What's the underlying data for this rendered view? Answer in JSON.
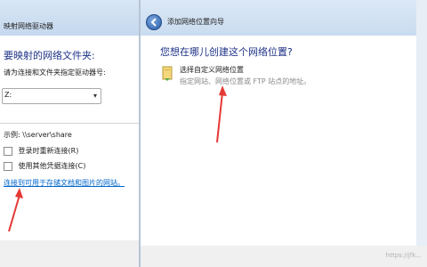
{
  "background_dialog": {
    "title": "映射网络驱动器",
    "heading": "要映射的网络文件夹:",
    "instruction": "请为连接和文件夹指定驱动器号:",
    "drive_select": {
      "value": "Z:"
    },
    "example": "示例: \\\\server\\share",
    "reconnect_label": "登录时重新连接(R)",
    "credentials_label": "使用其他凭据连接(C)",
    "link_text": "连接到可用于存储文档和图片的网站。"
  },
  "wizard": {
    "window_title": "添加网络位置向导",
    "heading": "您想在哪儿创建这个网络位置?",
    "options": [
      {
        "title": "选择自定义网络位置",
        "description": "指定网站、网络位置或 FTP 站点的地址。"
      }
    ]
  },
  "annotations": {
    "arrow_color": "#e53935"
  },
  "watermark": "https://jfk..."
}
